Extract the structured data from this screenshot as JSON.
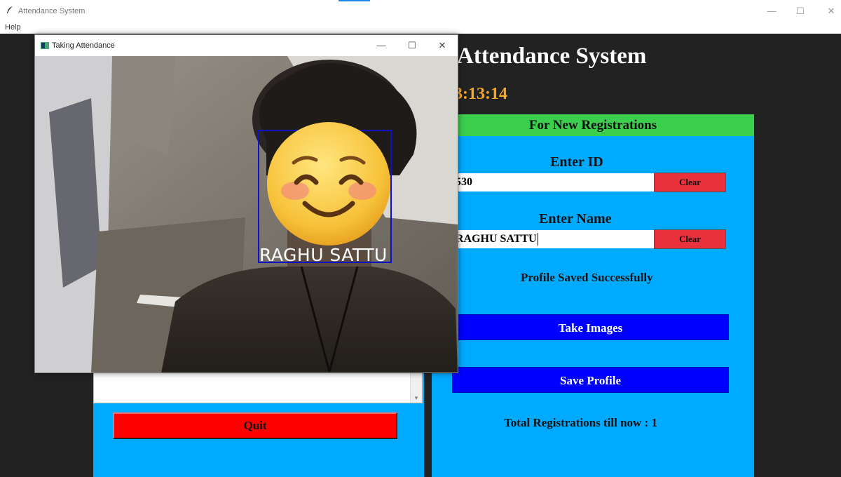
{
  "window": {
    "title": "Attendance System",
    "controls": {
      "minimize": "—",
      "maximize": "☐",
      "close": "✕"
    }
  },
  "menu": {
    "items": [
      "Help"
    ]
  },
  "app": {
    "title": "Attendance System",
    "clock": "3:13:14"
  },
  "left_panel": {
    "quit_label": "Quit"
  },
  "registration": {
    "header": "For New Registrations",
    "id_label": "Enter ID",
    "id_value": "530",
    "id_clear_label": "Clear",
    "name_label": "Enter Name",
    "name_value": "RAGHU SATTU",
    "name_clear_label": "Clear",
    "status_message": "Profile Saved Successfully",
    "take_images_label": "Take Images",
    "save_profile_label": "Save Profile",
    "total_registrations": "Total Registrations till now  : 1"
  },
  "popup": {
    "title": "Taking Attendance",
    "controls": {
      "minimize": "—",
      "maximize": "☐",
      "close": "✕"
    },
    "recognized_name": "RAGHU  SATTU"
  },
  "colors": {
    "app_background": "#222222",
    "panel_blue": "#00aaff",
    "header_green": "#3ccf4e",
    "button_blue": "#0000ff",
    "clear_red": "#e8313a",
    "quit_red": "#ff0000",
    "clock_orange": "#f5a623",
    "face_box": "#1010c8"
  },
  "icons": {
    "window_icon": "feather-icon",
    "popup_icon": "camera-window-icon",
    "face_overlay": "smiling-face-emoji-icon"
  }
}
